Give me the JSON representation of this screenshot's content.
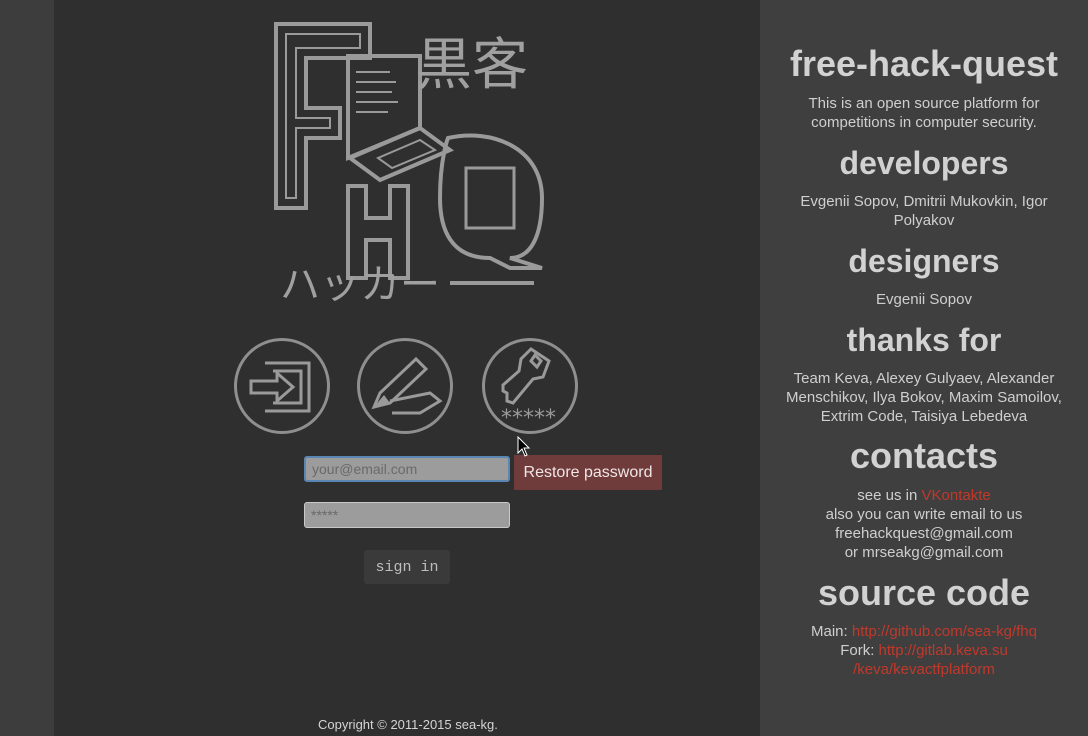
{
  "sidebar": {
    "title": "free-hack-quest",
    "description": "This is an open source platform for competitions in computer security.",
    "developers_heading": "developers",
    "developers_text": "Evgenii Sopov, Dmitrii Mukovkin, Igor Polyakov",
    "designers_heading": "designers",
    "designers_text": "Evgenii Sopov",
    "thanks_heading": "thanks for",
    "thanks_text": "Team Keva, Alexey Gulyaev, Alexander Menschikov, Ilya Bokov, Maxim Samoilov, Extrim Code, Taisiya Lebedeva",
    "contacts_heading": "contacts",
    "contacts_see_us": "see us in ",
    "contacts_vk": "VKontakte",
    "contacts_email_line": "also you can write email to us",
    "contacts_email1": "freehackquest@gmail.com",
    "contacts_email2": "or mrseakg@gmail.com",
    "source_heading": "source code",
    "source_main_label": "Main: ",
    "source_main_link": "http://github.com/sea-kg/fhq",
    "source_fork_label": "Fork: ",
    "source_fork_link_1": "http://gitlab.keva.su",
    "source_fork_link_2": "/keva/kevactfplatform"
  },
  "logo": {
    "letters": "FHQ",
    "kanji": "黒客",
    "katakana": "ハッカー",
    "password_mask": "*****"
  },
  "login": {
    "email_placeholder": "your@email.com",
    "password_placeholder": "*****",
    "restore_label": "Restore password",
    "signin_label": "sign in"
  },
  "icons": [
    "login-icon",
    "register-icon",
    "restore-key-icon",
    "mouse-cursor-icon"
  ],
  "footer": {
    "copyright": "Copyright © 2011-2015 sea-kg."
  },
  "colors": {
    "main_bg": "#2f2f2f",
    "side_bg": "#3f3f3f",
    "accent_link": "#c0392b",
    "restore_bg": "#6f3b3b",
    "icon_stroke": "#8f8f8f"
  }
}
